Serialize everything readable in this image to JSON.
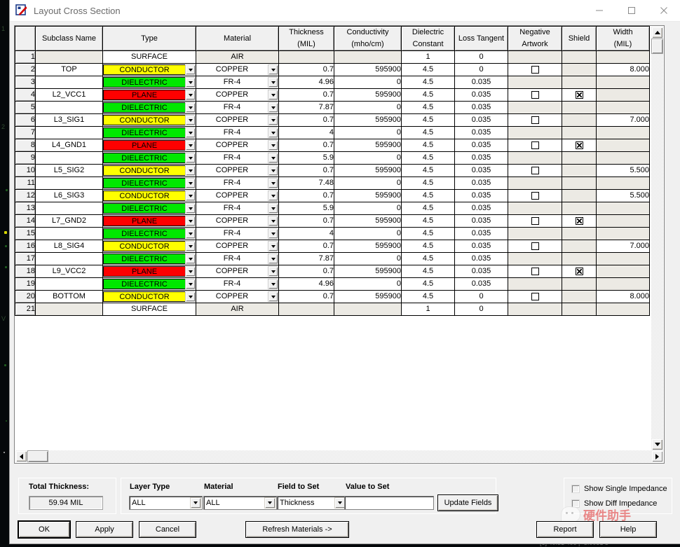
{
  "window": {
    "title": "Layout Cross Section",
    "app_icon": "allegro-icon",
    "minimize": "—",
    "maximize": "☐",
    "close": "✕"
  },
  "table": {
    "columns": [
      {
        "key": "rownum",
        "label": "",
        "label2": ""
      },
      {
        "key": "subclass",
        "label": "Subclass Name",
        "label2": ""
      },
      {
        "key": "type",
        "label": "Type",
        "label2": ""
      },
      {
        "key": "material",
        "label": "Material",
        "label2": ""
      },
      {
        "key": "thickness",
        "label": "Thickness",
        "label2": "(MIL)"
      },
      {
        "key": "conductivity",
        "label": "Conductivity",
        "label2": "(mho/cm)"
      },
      {
        "key": "dielectric",
        "label": "Dielectric",
        "label2": "Constant"
      },
      {
        "key": "loss",
        "label": "Loss Tangent",
        "label2": ""
      },
      {
        "key": "negative",
        "label": "Negative",
        "label2": "Artwork"
      },
      {
        "key": "shield",
        "label": "Shield",
        "label2": ""
      },
      {
        "key": "width",
        "label": "Width",
        "label2": "(MIL)"
      }
    ],
    "rows": [
      {
        "n": "1",
        "subclass": "",
        "type": "SURFACE",
        "type_style": "plain",
        "material": "AIR",
        "thickness": "",
        "conductivity": "",
        "dielectric": "1",
        "loss": "0",
        "negative": "",
        "shield": "",
        "width": ""
      },
      {
        "n": "2",
        "subclass": "TOP",
        "type": "CONDUCTOR",
        "type_style": "conductor",
        "material": "COPPER",
        "thickness": "0.7",
        "conductivity": "595900",
        "dielectric": "4.5",
        "loss": "0",
        "negative": "unchecked",
        "shield": "",
        "width": "8.000"
      },
      {
        "n": "3",
        "subclass": "",
        "type": "DIELECTRIC",
        "type_style": "dielectric",
        "material": "FR-4",
        "thickness": "4.96",
        "conductivity": "0",
        "dielectric": "4.5",
        "loss": "0.035",
        "negative": "",
        "shield": "",
        "width": ""
      },
      {
        "n": "4",
        "subclass": "L2_VCC1",
        "type": "PLANE",
        "type_style": "plane",
        "material": "COPPER",
        "thickness": "0.7",
        "conductivity": "595900",
        "dielectric": "4.5",
        "loss": "0.035",
        "negative": "unchecked",
        "shield": "checked",
        "width": ""
      },
      {
        "n": "5",
        "subclass": "",
        "type": "DIELECTRIC",
        "type_style": "dielectric",
        "material": "FR-4",
        "thickness": "7.87",
        "conductivity": "0",
        "dielectric": "4.5",
        "loss": "0.035",
        "negative": "",
        "shield": "",
        "width": ""
      },
      {
        "n": "6",
        "subclass": "L3_SIG1",
        "type": "CONDUCTOR",
        "type_style": "conductor",
        "material": "COPPER",
        "thickness": "0.7",
        "conductivity": "595900",
        "dielectric": "4.5",
        "loss": "0.035",
        "negative": "unchecked",
        "shield": "",
        "width": "7.000"
      },
      {
        "n": "7",
        "subclass": "",
        "type": "DIELECTRIC",
        "type_style": "dielectric",
        "material": "FR-4",
        "thickness": "4",
        "conductivity": "0",
        "dielectric": "4.5",
        "loss": "0.035",
        "negative": "",
        "shield": "",
        "width": ""
      },
      {
        "n": "8",
        "subclass": "L4_GND1",
        "type": "PLANE",
        "type_style": "plane",
        "material": "COPPER",
        "thickness": "0.7",
        "conductivity": "595900",
        "dielectric": "4.5",
        "loss": "0.035",
        "negative": "unchecked",
        "shield": "checked",
        "width": ""
      },
      {
        "n": "9",
        "subclass": "",
        "type": "DIELECTRIC",
        "type_style": "dielectric",
        "material": "FR-4",
        "thickness": "5.9",
        "conductivity": "0",
        "dielectric": "4.5",
        "loss": "0.035",
        "negative": "",
        "shield": "",
        "width": ""
      },
      {
        "n": "10",
        "subclass": "L5_SIG2",
        "type": "CONDUCTOR",
        "type_style": "conductor",
        "material": "COPPER",
        "thickness": "0.7",
        "conductivity": "595900",
        "dielectric": "4.5",
        "loss": "0.035",
        "negative": "unchecked",
        "shield": "",
        "width": "5.500"
      },
      {
        "n": "11",
        "subclass": "",
        "type": "DIELECTRIC",
        "type_style": "dielectric",
        "material": "FR-4",
        "thickness": "7.48",
        "conductivity": "0",
        "dielectric": "4.5",
        "loss": "0.035",
        "negative": "",
        "shield": "",
        "width": ""
      },
      {
        "n": "12",
        "subclass": "L6_SIG3",
        "type": "CONDUCTOR",
        "type_style": "conductor",
        "material": "COPPER",
        "thickness": "0.7",
        "conductivity": "595900",
        "dielectric": "4.5",
        "loss": "0.035",
        "negative": "unchecked",
        "shield": "",
        "width": "5.500"
      },
      {
        "n": "13",
        "subclass": "",
        "type": "DIELECTRIC",
        "type_style": "dielectric",
        "material": "FR-4",
        "thickness": "5.9",
        "conductivity": "0",
        "dielectric": "4.5",
        "loss": "0.035",
        "negative": "",
        "shield": "",
        "width": ""
      },
      {
        "n": "14",
        "subclass": "L7_GND2",
        "type": "PLANE",
        "type_style": "plane",
        "material": "COPPER",
        "thickness": "0.7",
        "conductivity": "595900",
        "dielectric": "4.5",
        "loss": "0.035",
        "negative": "unchecked",
        "shield": "checked",
        "width": ""
      },
      {
        "n": "15",
        "subclass": "",
        "type": "DIELECTRIC",
        "type_style": "dielectric",
        "material": "FR-4",
        "thickness": "4",
        "conductivity": "0",
        "dielectric": "4.5",
        "loss": "0.035",
        "negative": "",
        "shield": "",
        "width": ""
      },
      {
        "n": "16",
        "subclass": "L8_SIG4",
        "type": "CONDUCTOR",
        "type_style": "conductor",
        "material": "COPPER",
        "thickness": "0.7",
        "conductivity": "595900",
        "dielectric": "4.5",
        "loss": "0.035",
        "negative": "unchecked",
        "shield": "",
        "width": "7.000"
      },
      {
        "n": "17",
        "subclass": "",
        "type": "DIELECTRIC",
        "type_style": "dielectric",
        "material": "FR-4",
        "thickness": "7.87",
        "conductivity": "0",
        "dielectric": "4.5",
        "loss": "0.035",
        "negative": "",
        "shield": "",
        "width": ""
      },
      {
        "n": "18",
        "subclass": "L9_VCC2",
        "type": "PLANE",
        "type_style": "plane",
        "material": "COPPER",
        "thickness": "0.7",
        "conductivity": "595900",
        "dielectric": "4.5",
        "loss": "0.035",
        "negative": "unchecked",
        "shield": "checked",
        "width": ""
      },
      {
        "n": "19",
        "subclass": "",
        "type": "DIELECTRIC",
        "type_style": "dielectric",
        "material": "FR-4",
        "thickness": "4.96",
        "conductivity": "0",
        "dielectric": "4.5",
        "loss": "0.035",
        "negative": "",
        "shield": "",
        "width": ""
      },
      {
        "n": "20",
        "subclass": "BOTTOM",
        "type": "CONDUCTOR",
        "type_style": "conductor",
        "material": "COPPER",
        "thickness": "0.7",
        "conductivity": "595900",
        "dielectric": "4.5",
        "loss": "0",
        "negative": "unchecked",
        "shield": "",
        "width": "8.000"
      },
      {
        "n": "21",
        "subclass": "",
        "type": "SURFACE",
        "type_style": "plain",
        "material": "AIR",
        "thickness": "",
        "conductivity": "",
        "dielectric": "1",
        "loss": "0",
        "negative": "",
        "shield": "",
        "width": ""
      }
    ]
  },
  "total_thickness": {
    "label": "Total Thickness:",
    "value": "59.94 MIL"
  },
  "fields": {
    "layer_type_label": "Layer Type",
    "layer_type_value": "ALL",
    "material_label": "Material",
    "material_value": "ALL",
    "field_to_set_label": "Field to Set",
    "field_to_set_value": "Thickness",
    "value_to_set_label": "Value to Set",
    "value_to_set_value": "",
    "update_fields_label": "Update Fields"
  },
  "impedance": {
    "show_single": "Show Single Impedance",
    "show_diff": "Show Diff Impedance",
    "single_checked": false,
    "diff_checked": false
  },
  "buttons": {
    "ok": "OK",
    "apply": "Apply",
    "cancel": "Cancel",
    "refresh_materials": "Refresh Materials ->",
    "report": "Report",
    "help": "Help"
  },
  "watermark": {
    "text": "硬件助手",
    "logo": "wechat-icon"
  },
  "colors": {
    "conductor": "#ffff00",
    "dielectric": "#00e800",
    "plane": "#fe0000",
    "window_bg": "#f0f0f0",
    "grid_row_gray": "#eceae4"
  }
}
